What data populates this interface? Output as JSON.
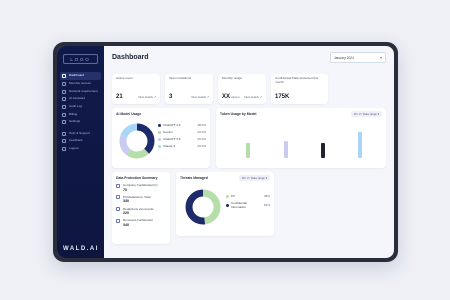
{
  "sidebar": {
    "logo": "LOGO",
    "brand": "WALD.AI",
    "items": [
      {
        "label": "Dashboard",
        "active": true
      },
      {
        "label": "Member access"
      },
      {
        "label": "Network requirement"
      },
      {
        "label": "AI Assistant"
      },
      {
        "label": "Audit Log"
      },
      {
        "label": "Billing"
      },
      {
        "label": "Settings"
      },
      {
        "label": "Help & Support"
      },
      {
        "label": "Feedback"
      },
      {
        "label": "Logout"
      }
    ]
  },
  "header": {
    "title": "Dashboard",
    "date_selector": "January 2024"
  },
  "stats": [
    {
      "label": "Active users",
      "value": "21",
      "unit": "",
      "link": "View details"
    },
    {
      "label": "Open invitations",
      "value": "3",
      "unit": "",
      "link": "View details"
    },
    {
      "label": "Monthly usage",
      "value": "XX",
      "unit": "tokens",
      "link": "View details"
    },
    {
      "label": "Confidential Data protected this month",
      "value": "175K",
      "unit": "",
      "link": ""
    }
  ],
  "ai_model_usage": {
    "title": "AI Model Usage",
    "slices": [
      {
        "label": "ChatGPT 4.0",
        "value": 38,
        "display": "38.0%",
        "color": "#1d2b6b"
      },
      {
        "label": "Gemini",
        "value": 22,
        "display": "22.0%",
        "color": "#b6dea9"
      },
      {
        "label": "ChatGPT 3.5",
        "value": 20,
        "display": "20.0%",
        "color": "#c9ccf0"
      },
      {
        "label": "Claude 3",
        "value": 20,
        "display": "20.0%",
        "color": "#a9d6f6"
      }
    ]
  },
  "token_usage": {
    "title": "Token Usage by Model",
    "filter": "16 / 2 / Date range",
    "bars": [
      {
        "value": 40,
        "color": "#b6dea9"
      },
      {
        "value": 45,
        "color": "#c9ccf0"
      },
      {
        "value": 40,
        "color": "#1f2433"
      },
      {
        "value": 70,
        "color": "#a9d6f6"
      }
    ]
  },
  "data_protection": {
    "title": "Data Protection Summary",
    "items": [
      {
        "label": "Company Confidential (C)",
        "value": "70"
      },
      {
        "label": "PII Redactions, Total",
        "value": "330"
      },
      {
        "label": "Redactions via records",
        "value": "220"
      },
      {
        "label": "Removed Confidential",
        "value": "340"
      }
    ]
  },
  "threats": {
    "title": "Threats Managed",
    "filter": "18 / 2 / Date range",
    "slices": [
      {
        "label": "PII",
        "value": 48,
        "display": "48%",
        "color": "#b6dea9"
      },
      {
        "label": "Confidential Information",
        "value": 52,
        "display": "52%",
        "color": "#1d2b6b"
      }
    ]
  }
}
